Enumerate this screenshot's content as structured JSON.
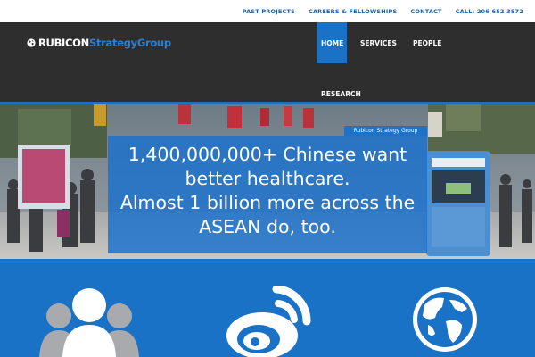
{
  "top_links": [
    "PAST PROJECTS",
    "CAREERS & FELLOWSHIPS",
    "CONTACT",
    "CALL: 206 652 3572"
  ],
  "logo": {
    "part1": "RUBICON",
    "part2": "StrategyGroup",
    "icon": "globe-icon"
  },
  "nav": {
    "home": "HOME",
    "services": "SERVICES",
    "people": "PEOPLE",
    "research": "RESEARCH",
    "active": "HOME"
  },
  "hero": {
    "badge": "Rubicon Strategy Group",
    "lines": [
      "1,400,000,000+ Chinese want",
      "better healthcare.",
      "Almost 1 billion more across the",
      "ASEAN do, too."
    ]
  },
  "features": [
    {
      "icon": "people-group-icon"
    },
    {
      "icon": "weibo-icon"
    },
    {
      "icon": "globe-icon"
    }
  ],
  "colors": {
    "accent": "#1a72c7",
    "header_bg": "#2e2e2e",
    "link": "#1a5fa8",
    "logo_blue": "#2f7fd0"
  }
}
